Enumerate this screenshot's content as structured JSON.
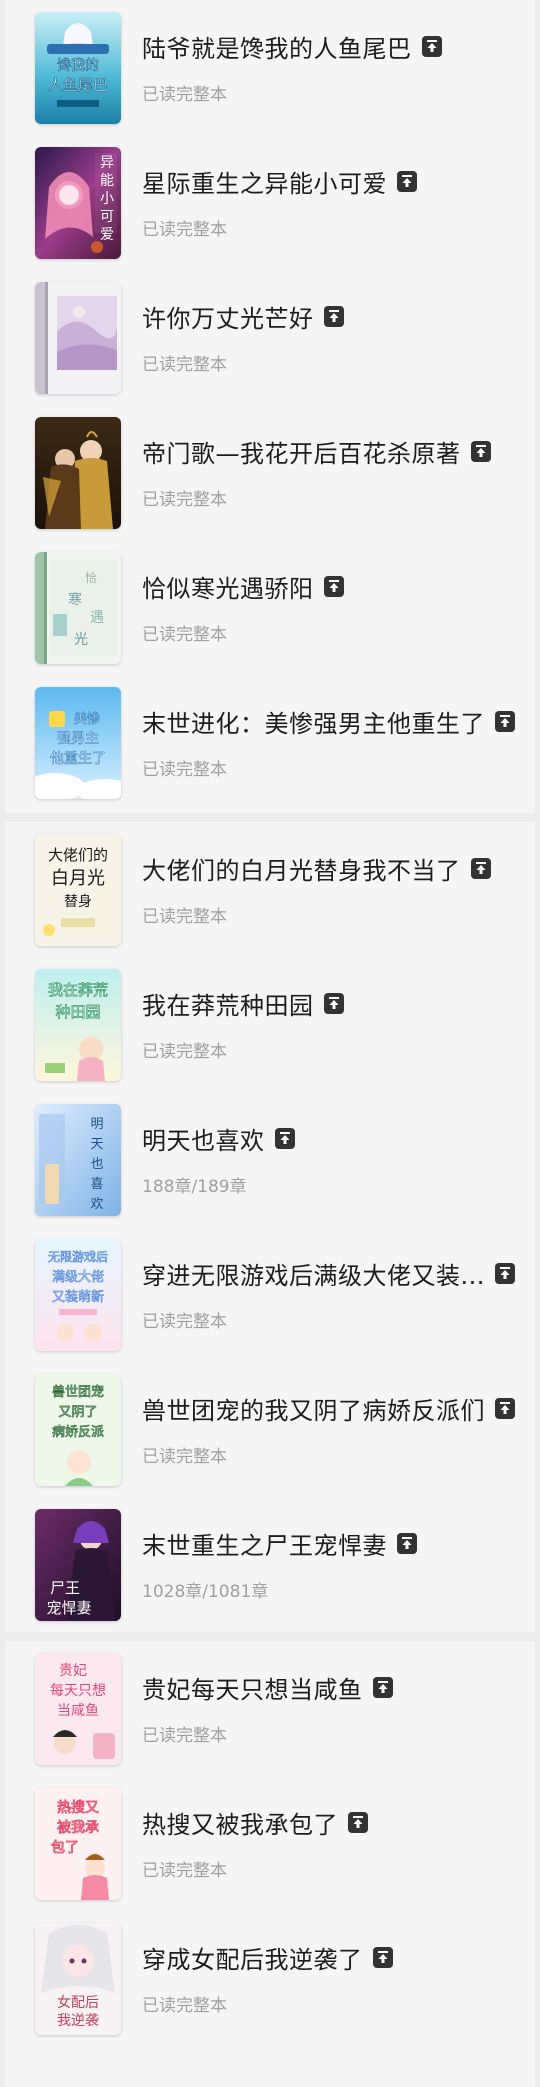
{
  "colors": {
    "background": "#ececec",
    "card": "#f5f5f5",
    "title": "#1d1d1d",
    "subtitle": "#a0a0a0",
    "pin_badge": "#333333"
  },
  "groups": [
    {
      "items": [
        {
          "title": "陆爷就是馋我的人鱼尾巴",
          "status": "已读完整本",
          "cover_text": "馋我的人鱼尾巴",
          "pinned_icon": "pin-top-icon"
        },
        {
          "title": "星际重生之异能小可爱",
          "status": "已读完整本",
          "cover_text": "异能小可爱",
          "pinned_icon": "pin-top-icon"
        },
        {
          "title": "许你万丈光芒好",
          "status": "已读完整本",
          "cover_text": "",
          "pinned_icon": "pin-top-icon"
        },
        {
          "title": "帝门歌—我花开后百花杀原著",
          "status": "已读完整本",
          "cover_text": "",
          "pinned_icon": "pin-top-icon"
        },
        {
          "title": "恰似寒光遇骄阳",
          "status": "已读完整本",
          "cover_text": "寒光",
          "pinned_icon": "pin-top-icon"
        },
        {
          "title": "末世进化：美惨强男主他重生了",
          "status": "已读完整本",
          "cover_text": "美惨强男主他重生了",
          "pinned_icon": "pin-top-icon"
        }
      ]
    },
    {
      "items": [
        {
          "title": "大佬们的白月光替身我不当了",
          "status": "已读完整本",
          "cover_text": "大佬们的白月光",
          "pinned_icon": "pin-top-icon"
        },
        {
          "title": "我在莽荒种田园",
          "status": "已读完整本",
          "cover_text": "我在莽荒种田园",
          "pinned_icon": "pin-top-icon"
        },
        {
          "title": "明天也喜欢",
          "status": "188章/189章",
          "cover_text": "明天也喜欢",
          "pinned_icon": "pin-top-icon"
        },
        {
          "title": "穿进无限游戏后满级大佬又装...",
          "status": "已读完整本",
          "cover_text": "无限游戏后满级大佬又装萌新",
          "pinned_icon": "pin-top-icon"
        },
        {
          "title": "兽世团宠的我又阴了病娇反派们",
          "status": "已读完整本",
          "cover_text": "兽世团宠病娇反派",
          "pinned_icon": "pin-top-icon"
        },
        {
          "title": "末世重生之尸王宠悍妻",
          "status": "1028章/1081章",
          "cover_text": "尸王宠悍妻",
          "pinned_icon": "pin-top-icon"
        }
      ]
    },
    {
      "items": [
        {
          "title": "贵妃每天只想当咸鱼",
          "status": "已读完整本",
          "cover_text": "贵妃每天只想当咸鱼",
          "pinned_icon": "pin-top-icon"
        },
        {
          "title": "热搜又被我承包了",
          "status": "已读完整本",
          "cover_text": "热搜又被我承包了",
          "pinned_icon": "pin-top-icon"
        },
        {
          "title": "穿成女配后我逆袭了",
          "status": "已读完整本",
          "cover_text": "女配后我逆袭",
          "pinned_icon": "pin-top-icon"
        }
      ]
    }
  ]
}
